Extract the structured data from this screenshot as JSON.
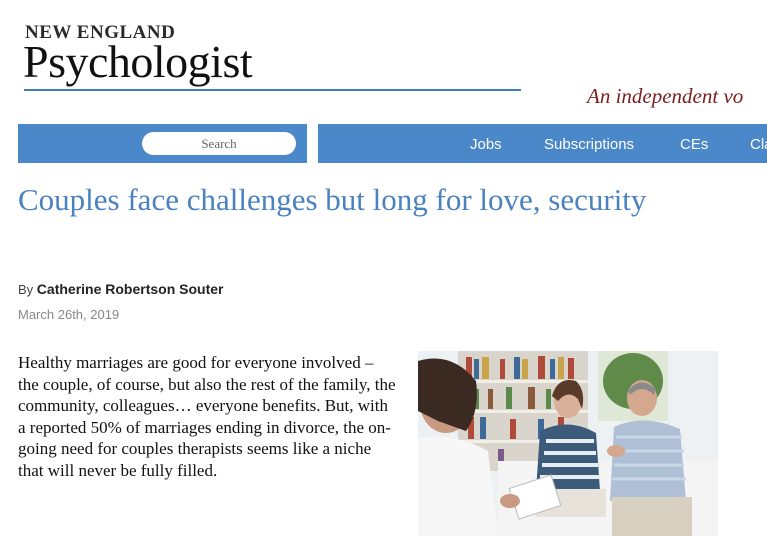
{
  "masthead": {
    "kicker": "NEW ENGLAND",
    "title": "Psychologist",
    "tagline": "An independent vo"
  },
  "search": {
    "placeholder": "Search"
  },
  "nav": {
    "items": [
      {
        "label": "Jobs"
      },
      {
        "label": "Subscriptions"
      },
      {
        "label": "CEs"
      },
      {
        "label": "Cla"
      }
    ]
  },
  "article": {
    "title": "Couples face challenges but long for love, security",
    "byline_prefix": "By",
    "author": "Catherine Robertson Souter",
    "date": "March 26th, 2019",
    "body": "Healthy marriages are good for everyone involved – the couple, of course, but also the rest of the family, the community, colleagues… everyone benefits. But, with a reported 50% of marriages ending in divorce, the on-going need for couples therapists seems like a niche that will never be fully filled."
  },
  "colors": {
    "accent": "#4a88c9",
    "title": "#4a82c0",
    "tagline": "#7a1d1d",
    "rule": "#3d7ec1"
  }
}
